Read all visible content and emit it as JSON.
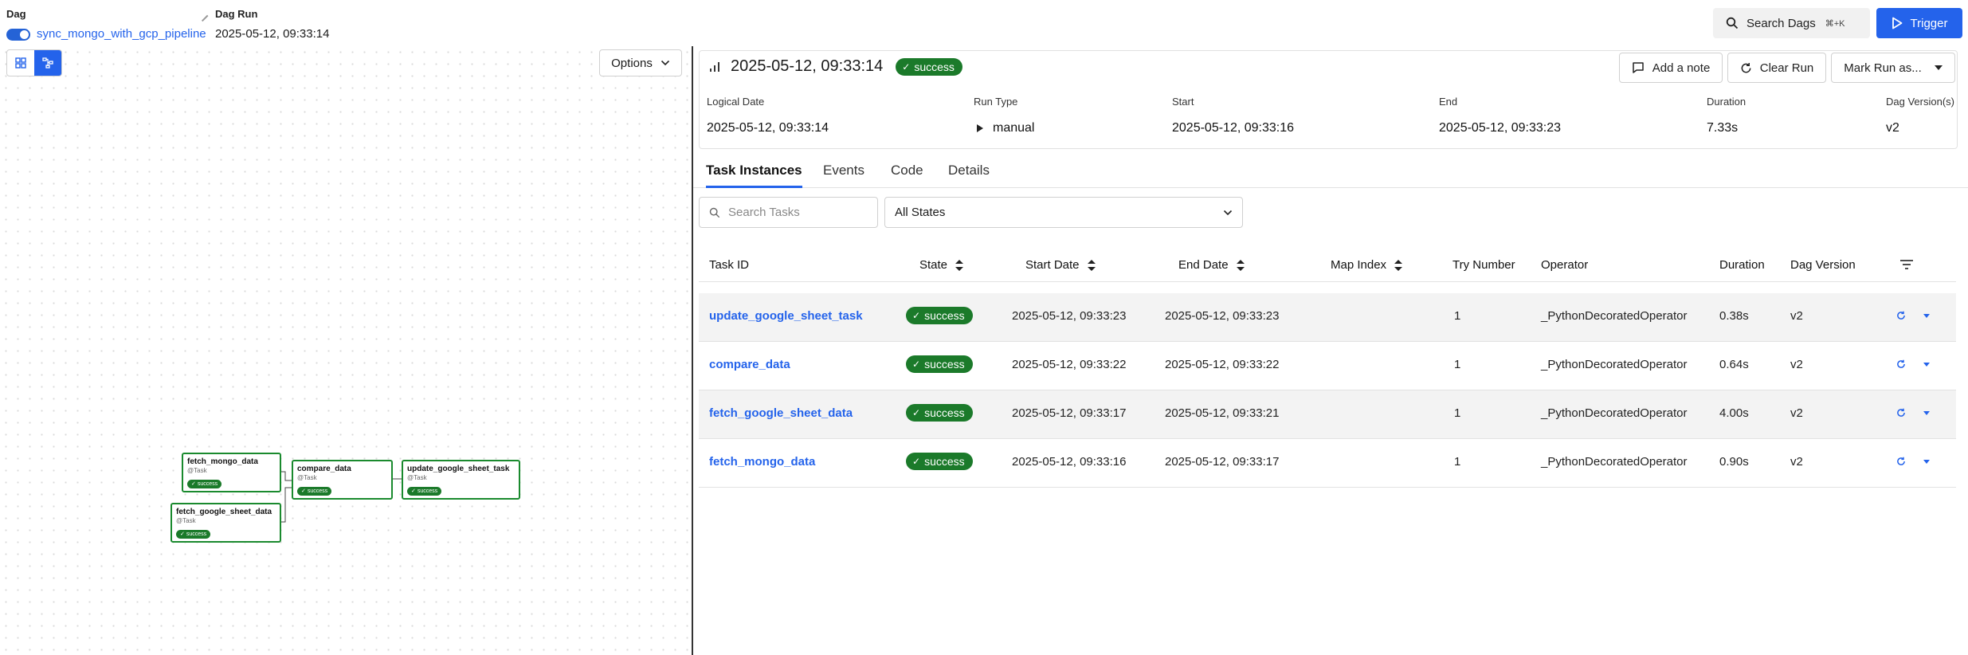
{
  "header": {
    "dag_label": "Dag",
    "dag_name": "sync_mongo_with_gcp_pipeline",
    "dag_run_label": "Dag Run",
    "dag_run_value": "2025-05-12, 09:33:14",
    "search_dags_label": "Search Dags",
    "search_shortcut": "⌘+K",
    "trigger_label": "Trigger"
  },
  "graph": {
    "options_label": "Options",
    "nodes": [
      {
        "title": "fetch_mongo_data",
        "subtitle": "@Task",
        "state": "success"
      },
      {
        "title": "fetch_google_sheet_data",
        "subtitle": "@Task",
        "state": "success"
      },
      {
        "title": "compare_data",
        "subtitle": "@Task",
        "state": "success"
      },
      {
        "title": "update_google_sheet_task",
        "subtitle": "@Task",
        "state": "success"
      }
    ]
  },
  "run": {
    "title": "2025-05-12, 09:33:14",
    "state": "success",
    "add_note_label": "Add a note",
    "clear_run_label": "Clear Run",
    "mark_run_label": "Mark Run as...",
    "meta": [
      {
        "label": "Logical Date",
        "value": "2025-05-12, 09:33:14"
      },
      {
        "label": "Run Type",
        "value": "manual"
      },
      {
        "label": "Start",
        "value": "2025-05-12, 09:33:16"
      },
      {
        "label": "End",
        "value": "2025-05-12, 09:33:23"
      },
      {
        "label": "Duration",
        "value": "7.33s"
      },
      {
        "label": "Dag Version(s)",
        "value": "v2"
      }
    ]
  },
  "tabs": [
    "Task Instances",
    "Events",
    "Code",
    "Details"
  ],
  "filters": {
    "search_placeholder": "Search Tasks",
    "state_value": "All States"
  },
  "table": {
    "columns": [
      "Task ID",
      "State",
      "Start Date",
      "End Date",
      "Map Index",
      "Try Number",
      "Operator",
      "Duration",
      "Dag Version"
    ],
    "rows": [
      {
        "task_id": "update_google_sheet_task",
        "state": "success",
        "start": "2025-05-12, 09:33:23",
        "end": "2025-05-12, 09:33:23",
        "map_index": "",
        "try": "1",
        "operator": "_PythonDecoratedOperator",
        "duration": "0.38s",
        "version": "v2"
      },
      {
        "task_id": "compare_data",
        "state": "success",
        "start": "2025-05-12, 09:33:22",
        "end": "2025-05-12, 09:33:22",
        "map_index": "",
        "try": "1",
        "operator": "_PythonDecoratedOperator",
        "duration": "0.64s",
        "version": "v2"
      },
      {
        "task_id": "fetch_google_sheet_data",
        "state": "success",
        "start": "2025-05-12, 09:33:17",
        "end": "2025-05-12, 09:33:21",
        "map_index": "",
        "try": "1",
        "operator": "_PythonDecoratedOperator",
        "duration": "4.00s",
        "version": "v2"
      },
      {
        "task_id": "fetch_mongo_data",
        "state": "success",
        "start": "2025-05-12, 09:33:16",
        "end": "2025-05-12, 09:33:17",
        "map_index": "",
        "try": "1",
        "operator": "_PythonDecoratedOperator",
        "duration": "0.90s",
        "version": "v2"
      }
    ]
  },
  "colors": {
    "accent": "#2463eb",
    "success": "#1b7a2a"
  }
}
